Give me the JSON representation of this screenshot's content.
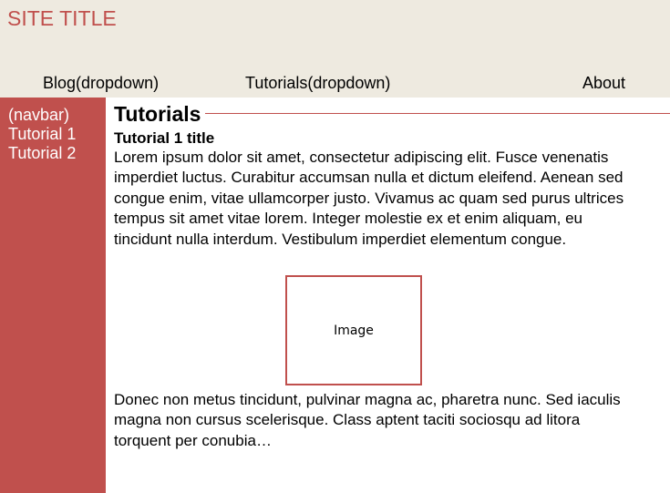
{
  "header": {
    "site_title": "SITE TITLE",
    "nav": {
      "blog": "Blog(dropdown)",
      "tutorials": "Tutorials(dropdown)",
      "about": "About"
    }
  },
  "sidebar": {
    "items": [
      "(navbar)",
      "Tutorial 1",
      "Tutorial 2"
    ]
  },
  "main": {
    "heading": "Tutorials",
    "article_title": "Tutorial 1 title",
    "paragraph_1": "Lorem ipsum dolor sit amet, consectetur adipiscing elit. Fusce venenatis imperdiet luctus. Curabitur accumsan nulla et dictum eleifend. Aenean sed congue enim, vitae ullamcorper justo. Vivamus ac quam sed purus ultrices tempus sit amet vitae lorem. Integer molestie ex et enim aliquam, eu tincidunt nulla interdum. Vestibulum imperdiet elementum congue.",
    "image_label": "Image",
    "paragraph_2": "Donec non metus tincidunt, pulvinar magna ac, pharetra nunc. Sed iaculis magna non cursus scelerisque. Class aptent taciti sociosqu ad litora torquent per conubia…"
  },
  "colors": {
    "accent": "#c0504d",
    "header_bg": "#eeeae0",
    "sidebar_text": "#ffffff"
  }
}
